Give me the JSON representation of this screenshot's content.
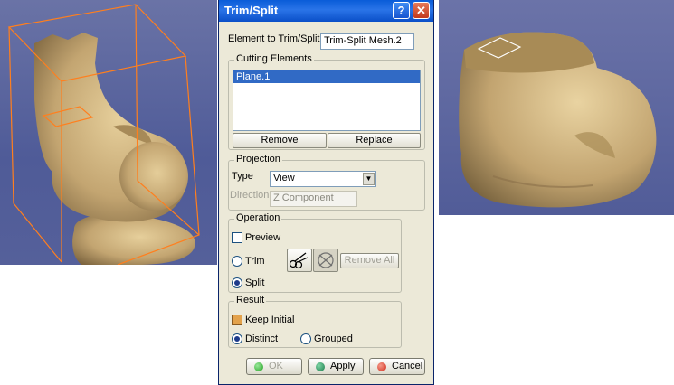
{
  "dialog": {
    "title": "Trim/Split",
    "help_glyph": "?",
    "close_glyph": "✕",
    "element_to_trim": {
      "label": "Element to Trim/Split",
      "value": "Trim-Split Mesh.2"
    },
    "cutting_elements": {
      "title": "Cutting Elements",
      "items": [
        "Plane.1"
      ],
      "remove_label": "Remove",
      "replace_label": "Replace"
    },
    "projection": {
      "title": "Projection",
      "type_label": "Type",
      "type_value": "View",
      "direction_label": "Direction",
      "direction_value": "Z Component"
    },
    "operation": {
      "title": "Operation",
      "preview_label": "Preview",
      "preview_checked": false,
      "trim_label": "Trim",
      "split_label": "Split",
      "selected": "Split",
      "remove_all_label": "Remove All"
    },
    "result": {
      "title": "Result",
      "keep_initial_label": "Keep Initial",
      "keep_initial_checked": true,
      "distinct_label": "Distinct",
      "grouped_label": "Grouped",
      "selected": "Distinct"
    },
    "ok_label": "OK",
    "apply_label": "Apply",
    "cancel_label": "Cancel"
  },
  "colors": {
    "titlebar": "#0a5cd8",
    "viewport_background": "#5a64a0",
    "bone": "#c8ac78",
    "bounding_box": "#ff7f1e",
    "list_selection": "#316ac5",
    "ok_dot": "#20a020",
    "apply_dot": "#1a7a4a",
    "cancel_dot": "#d02a1a"
  }
}
